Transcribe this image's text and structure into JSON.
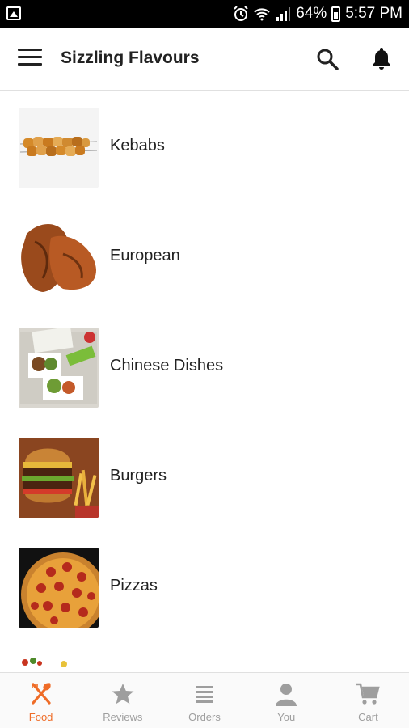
{
  "status_bar": {
    "battery": "64%",
    "time": "5:57 PM"
  },
  "app_bar": {
    "title": "Sizzling Flavours"
  },
  "categories": [
    {
      "label": "Kebabs"
    },
    {
      "label": "European"
    },
    {
      "label": "Chinese Dishes"
    },
    {
      "label": "Burgers"
    },
    {
      "label": "Pizzas"
    }
  ],
  "bottom_nav": {
    "items": [
      {
        "label": "Food",
        "icon": "fork-spoon-icon",
        "active": true
      },
      {
        "label": "Reviews",
        "icon": "star-icon",
        "active": false
      },
      {
        "label": "Orders",
        "icon": "list-icon",
        "active": false
      },
      {
        "label": "You",
        "icon": "person-icon",
        "active": false
      },
      {
        "label": "Cart",
        "icon": "cart-icon",
        "active": false
      }
    ]
  },
  "colors": {
    "accent": "#ef6c27",
    "inactive": "#9e9e9e",
    "status_bar": "#000000"
  }
}
